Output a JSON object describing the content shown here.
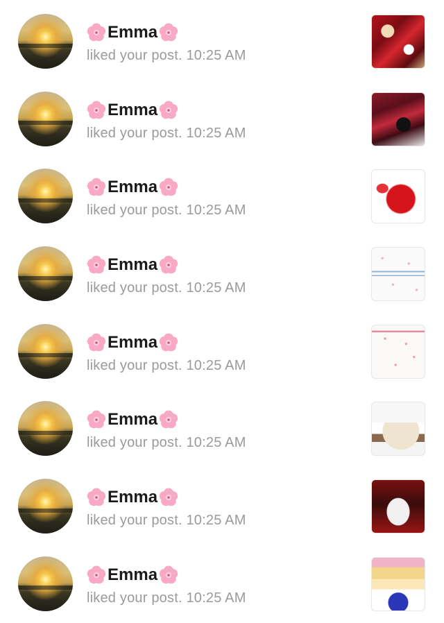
{
  "notifications": [
    {
      "user": "Emma",
      "flower": "cherry-blossom-icon",
      "action": "liked your post. 10:25 AM",
      "thumbnail": "red football collage"
    },
    {
      "user": "Emma",
      "flower": "cherry-blossom-icon",
      "action": "liked your post. 10:25 AM",
      "thumbnail": "dr pepper collage"
    },
    {
      "user": "Emma",
      "flower": "cherry-blossom-icon",
      "action": "liked your post. 10:25 AM",
      "thumbnail": "red outfit collage"
    },
    {
      "user": "Emma",
      "flower": "cherry-blossom-icon",
      "action": "liked your post. 10:25 AM",
      "thumbnail": "floral pattern with blue text"
    },
    {
      "user": "Emma",
      "flower": "cherry-blossom-icon",
      "action": "liked your post. 10:25 AM",
      "thumbnail": "floral pattern with pink text"
    },
    {
      "user": "Emma",
      "flower": "cherry-blossom-icon",
      "action": "liked your post. 10:25 AM",
      "thumbnail": "slipper photo"
    },
    {
      "user": "Emma",
      "flower": "cherry-blossom-icon",
      "action": "liked your post. 10:25 AM",
      "thumbnail": "ghostface tumbler"
    },
    {
      "user": "Emma",
      "flower": "cherry-blossom-icon",
      "action": "liked your post. 10:25 AM",
      "thumbnail": "beauty products"
    }
  ],
  "colors": {
    "name": "#1a1a1a",
    "meta": "#9a9a9a",
    "flower": "#f7a9c5"
  }
}
